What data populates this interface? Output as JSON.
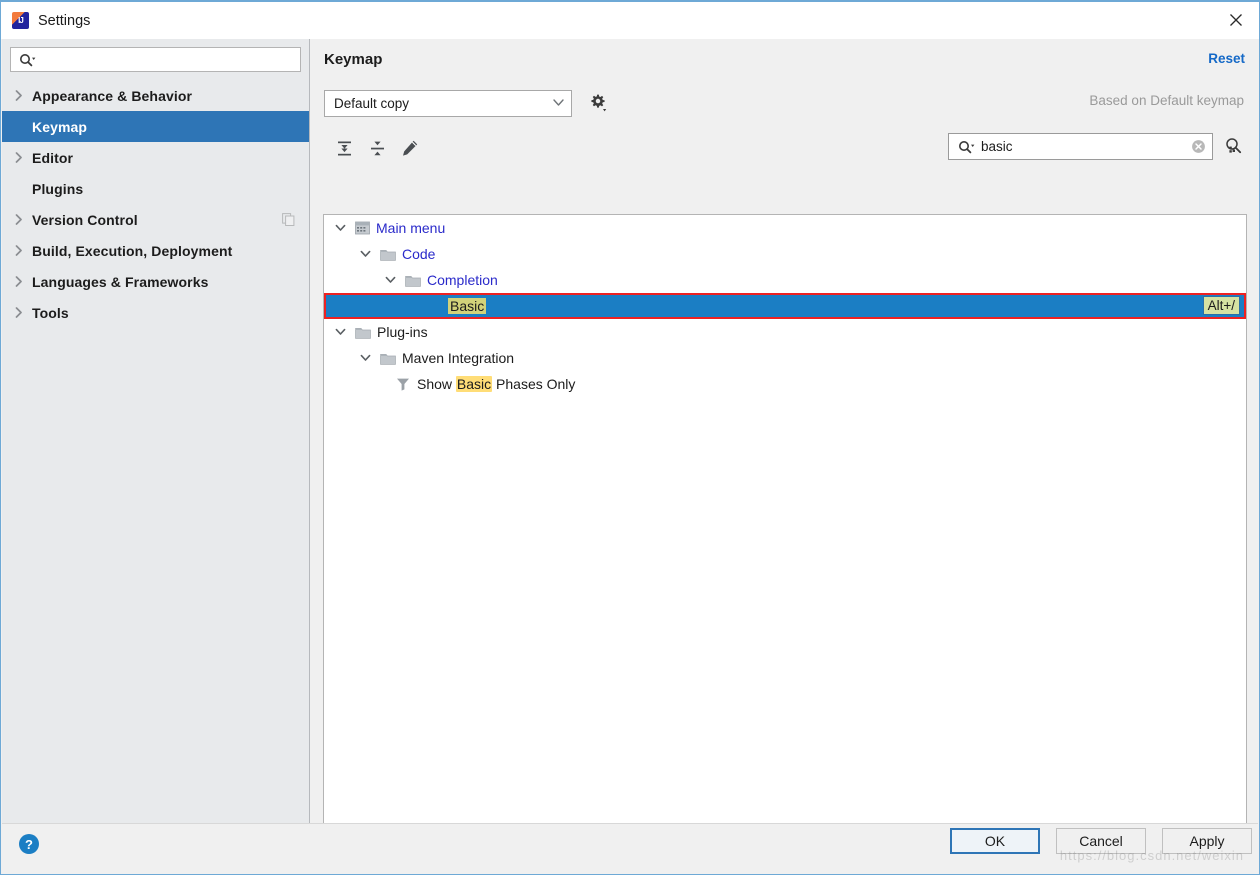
{
  "window": {
    "title": "Settings",
    "app_icon": "intellij-idea-icon",
    "close_icon": "close-icon"
  },
  "sidebar": {
    "search": {
      "value": "",
      "placeholder": "",
      "icon": "search-dropdown-icon"
    },
    "items": [
      {
        "label": "Appearance & Behavior",
        "expandable": true,
        "selected": false
      },
      {
        "label": "Keymap",
        "expandable": false,
        "selected": true
      },
      {
        "label": "Editor",
        "expandable": true,
        "selected": false
      },
      {
        "label": "Plugins",
        "expandable": false,
        "selected": false
      },
      {
        "label": "Version Control",
        "expandable": true,
        "selected": false,
        "extra_icon": "copy-icon"
      },
      {
        "label": "Build, Execution, Deployment",
        "expandable": true,
        "selected": false
      },
      {
        "label": "Languages & Frameworks",
        "expandable": true,
        "selected": false
      },
      {
        "label": "Tools",
        "expandable": true,
        "selected": false
      }
    ]
  },
  "keymap": {
    "title": "Keymap",
    "reset_label": "Reset",
    "selected_keymap": "Default copy",
    "based_on": "Based on Default keymap",
    "gear_icon": "gear-dropdown-icon",
    "toolbar": [
      {
        "name": "expand-all-icon",
        "tooltip": "Expand All"
      },
      {
        "name": "collapse-all-icon",
        "tooltip": "Collapse All"
      },
      {
        "name": "edit-shortcut-icon",
        "tooltip": "Edit Shortcut"
      }
    ],
    "search": {
      "value": "basic",
      "placeholder": "",
      "icon": "search-dropdown-icon",
      "clear_icon": "clear-circle-icon"
    },
    "find_by_shortcut_icon": "find-by-shortcut-icon"
  },
  "tree": {
    "rows": [
      {
        "label": "Main menu",
        "indent": 0,
        "twisty": "expanded",
        "icon": "main-menu-icon",
        "link": true,
        "selected": false,
        "highlight": "",
        "shortcut": ""
      },
      {
        "label": "Code",
        "indent": 1,
        "twisty": "expanded",
        "icon": "folder-icon",
        "link": true,
        "selected": false,
        "highlight": "",
        "shortcut": ""
      },
      {
        "label": "Completion",
        "indent": 2,
        "twisty": "expanded",
        "icon": "folder-icon",
        "link": true,
        "selected": false,
        "highlight": "",
        "shortcut": ""
      },
      {
        "label": "Basic",
        "indent": 3,
        "twisty": "none",
        "icon": "none",
        "link": false,
        "selected": true,
        "highlight": "Basic",
        "shortcut": "Alt+/"
      },
      {
        "label": "Plug-ins",
        "indent": 0,
        "twisty": "expanded",
        "icon": "folder-icon",
        "link": false,
        "selected": false,
        "highlight": "",
        "shortcut": ""
      },
      {
        "label": "Maven Integration",
        "indent": 1,
        "twisty": "expanded",
        "icon": "folder-icon",
        "link": false,
        "selected": false,
        "highlight": "",
        "shortcut": ""
      },
      {
        "label": "Show Basic Phases Only",
        "indent": 2,
        "twisty": "none",
        "icon": "filter-icon",
        "link": false,
        "selected": false,
        "highlight": "Basic",
        "shortcut": ""
      }
    ]
  },
  "footer": {
    "help_label": "?",
    "ok_label": "OK",
    "cancel_label": "Cancel",
    "apply_label": "Apply",
    "watermark": "https://blog.csdn.net/weixin"
  },
  "colors": {
    "selection_blue": "#2e75b6",
    "tree_selection_blue": "#1b7ec4",
    "link_blue": "#2a2aca",
    "reset_blue": "#1569c7",
    "highlight_yellow": "#ffdd77",
    "shortcut_chip": "#d6e2a2",
    "outline_red": "#ee2222",
    "panel_bg": "#f0f0f0",
    "sidebar_bg": "#e8eaec"
  }
}
